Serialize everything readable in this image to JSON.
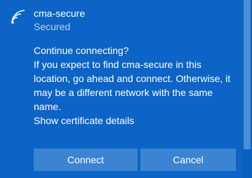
{
  "network": {
    "name": "cma-secure",
    "status": "Secured",
    "icon": "wifi-signal-icon"
  },
  "prompt": {
    "lines": [
      "Continue connecting?",
      "If you expect to find cma-secure in this",
      "location, go ahead and connect. Otherwise, it",
      "may be a different network with the same",
      "name."
    ],
    "certificate_link": "Show certificate details"
  },
  "buttons": {
    "connect_label": "Connect",
    "cancel_label": "Cancel"
  },
  "colors": {
    "background": "#0b64c6",
    "button": "#3b84d4",
    "status_text": "#b8d3f2"
  }
}
